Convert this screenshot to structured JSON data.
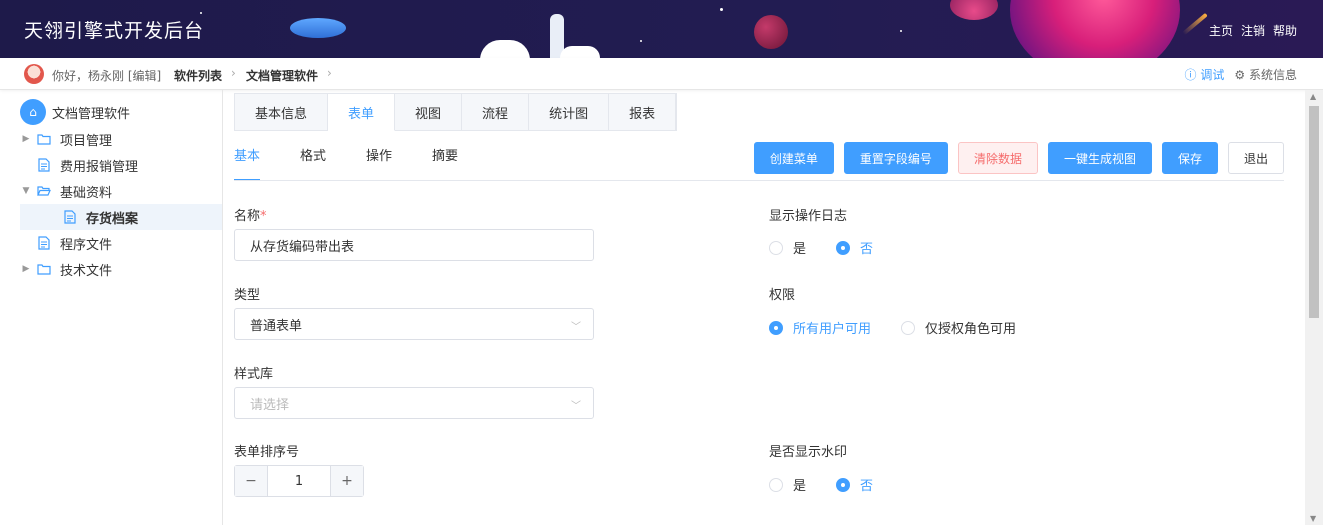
{
  "app": {
    "title": "天翎引擎式开发后台"
  },
  "header_links": [
    "主页",
    "注销",
    "帮助"
  ],
  "breadcrumb": {
    "greeting": "你好，杨永刚 [编辑]",
    "items": [
      "软件列表",
      "文档管理软件"
    ],
    "debug": "调试",
    "sysinfo": "系统信息"
  },
  "sidebar": {
    "root": "文档管理软件",
    "items": [
      {
        "label": "项目管理",
        "type": "folder",
        "arrow": "right"
      },
      {
        "label": "费用报销管理",
        "type": "doc"
      },
      {
        "label": "基础资料",
        "type": "folder-open",
        "arrow": "down"
      },
      {
        "label": "存货档案",
        "type": "doc",
        "active": true
      },
      {
        "label": "程序文件",
        "type": "doc"
      },
      {
        "label": "技术文件",
        "type": "folder",
        "arrow": "right"
      }
    ]
  },
  "tabs": [
    "基本信息",
    "表单",
    "视图",
    "流程",
    "统计图",
    "报表"
  ],
  "subtabs": [
    "基本",
    "格式",
    "操作",
    "摘要"
  ],
  "actions": {
    "create_menu": "创建菜单",
    "reset_field": "重置字段编号",
    "clear_data": "清除数据",
    "gen_view": "一键生成视图",
    "save": "保存",
    "exit": "退出"
  },
  "form": {
    "name_label": "名称",
    "name_value": "从存货编码带出表",
    "type_label": "类型",
    "type_value": "普通表单",
    "style_label": "样式库",
    "style_placeholder": "请选择",
    "order_label": "表单排序号",
    "order_value": "1",
    "log_label": "显示操作日志",
    "perm_label": "权限",
    "watermark_label": "是否显示水印",
    "yes": "是",
    "no": "否",
    "perm_all": "所有用户可用",
    "perm_role": "仅授权角色可用"
  },
  "colors": {
    "accent": "#409eff",
    "danger": "#f56c6c",
    "header_bg": "#1e1a4a"
  }
}
